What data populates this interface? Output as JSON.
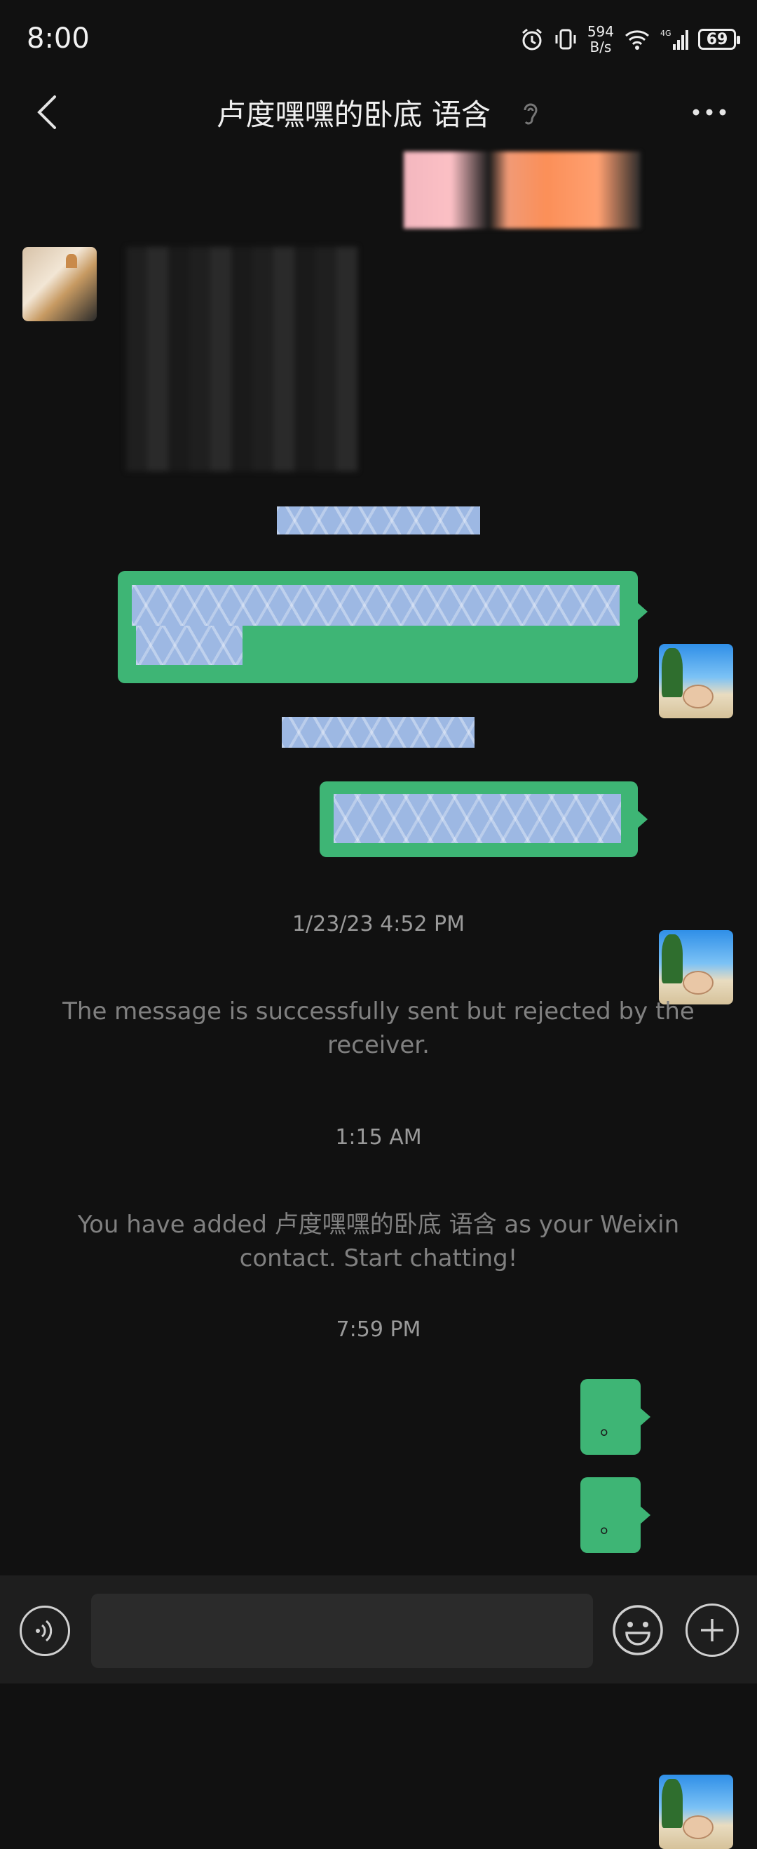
{
  "status": {
    "time": "8:00",
    "net_speed_top": "594",
    "net_speed_bottom": "B/s",
    "battery": "69",
    "network": "4G"
  },
  "header": {
    "title": "卢度嘿嘿的卧底 语含"
  },
  "messages": {
    "ts1": "1/23/23 4:52 PM",
    "sys1": "The message is successfully sent but rejected by the receiver.",
    "ts2": "1:15 AM",
    "sys2": "You have added 卢度嘿嘿的卧底 语含 as your Weixin contact. Start chatting!",
    "ts3": "7:59 PM",
    "dot1": "。",
    "dot2": "。"
  },
  "colors": {
    "bubble_out": "#3eb575",
    "background": "#111111"
  }
}
